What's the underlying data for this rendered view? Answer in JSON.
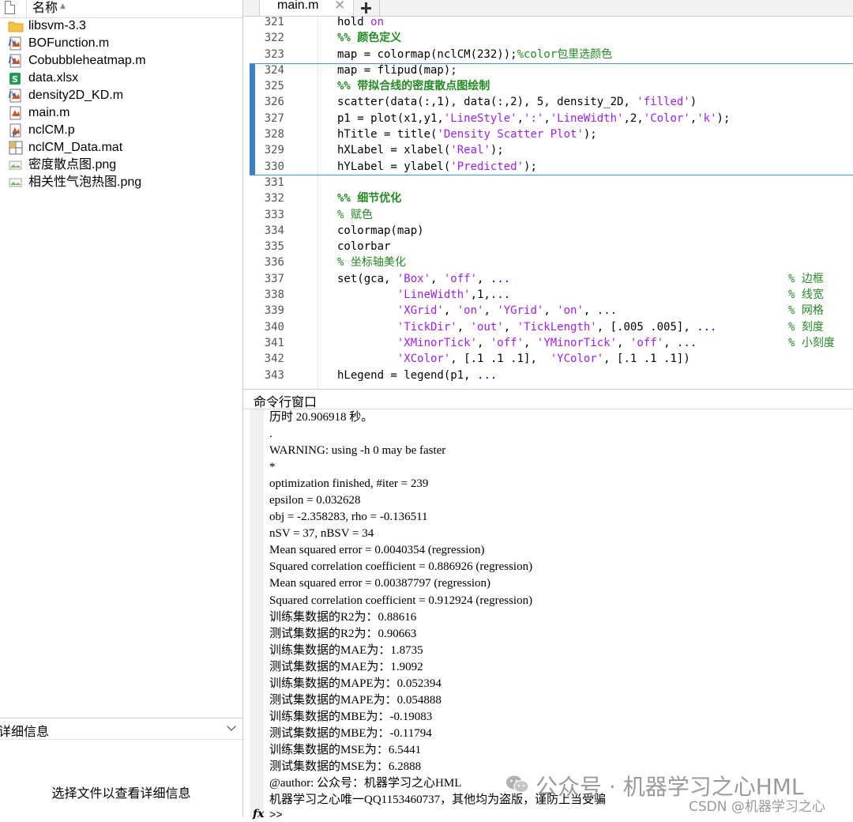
{
  "file_browser": {
    "column_name": "名称",
    "files": [
      {
        "name": "libsvm-3.3",
        "icon": "folder-icon"
      },
      {
        "name": "BOFunction.m",
        "icon": "matlab-function-icon"
      },
      {
        "name": "Cobubbleheatmap.m",
        "icon": "matlab-function-icon"
      },
      {
        "name": "data.xlsx",
        "icon": "excel-icon"
      },
      {
        "name": "density2D_KD.m",
        "icon": "matlab-function-icon"
      },
      {
        "name": "main.m",
        "icon": "matlab-script-icon"
      },
      {
        "name": "nclCM.p",
        "icon": "matlab-pcode-icon"
      },
      {
        "name": "nclCM_Data.mat",
        "icon": "mat-file-icon"
      },
      {
        "name": "密度散点图.png",
        "icon": "png-icon"
      },
      {
        "name": "相关性气泡热图.png",
        "icon": "png-icon"
      }
    ],
    "details_title": "详细信息",
    "details_message": "选择文件以查看详细信息"
  },
  "editor": {
    "tab_label": "main.m",
    "tab_close": "✕",
    "lines": [
      {
        "n": "321",
        "segs": [
          [
            "hold ",
            ""
          ],
          [
            "on",
            "str"
          ]
        ]
      },
      {
        "n": "322",
        "segs": [
          [
            "%% 颜色定义",
            "cmb"
          ]
        ]
      },
      {
        "n": "323",
        "segs": [
          [
            "map = colormap(nclCM(232));",
            ""
          ],
          [
            "%color包里选颜色",
            "cm"
          ]
        ]
      },
      {
        "n": "324",
        "segs": [
          [
            "map = flipud(map);",
            ""
          ]
        ]
      },
      {
        "n": "325",
        "segs": [
          [
            "%% 带拟合线的密度散点图绘制",
            "cmb"
          ]
        ]
      },
      {
        "n": "326",
        "segs": [
          [
            "scatter(data(:,1), data(:,2), 5, density_2D, ",
            ""
          ],
          [
            "'filled'",
            "str"
          ],
          [
            ")",
            ""
          ]
        ]
      },
      {
        "n": "327",
        "segs": [
          [
            "p1 = plot(x1,y1,",
            ""
          ],
          [
            "'LineStyle'",
            "str"
          ],
          [
            ",",
            ""
          ],
          [
            "':'",
            "str"
          ],
          [
            ",",
            ""
          ],
          [
            "'LineWidth'",
            "str"
          ],
          [
            ",2,",
            ""
          ],
          [
            "'Color'",
            "str"
          ],
          [
            ",",
            ""
          ],
          [
            "'k'",
            "str"
          ],
          [
            ");",
            ""
          ]
        ]
      },
      {
        "n": "328",
        "segs": [
          [
            "hTitle = title(",
            ""
          ],
          [
            "'Density Scatter Plot'",
            "str"
          ],
          [
            ");",
            ""
          ]
        ]
      },
      {
        "n": "329",
        "segs": [
          [
            "hXLabel = xlabel(",
            ""
          ],
          [
            "'Real'",
            "str"
          ],
          [
            ");",
            ""
          ]
        ]
      },
      {
        "n": "330",
        "segs": [
          [
            "hYLabel = ylabel(",
            ""
          ],
          [
            "'Predicted'",
            "str"
          ],
          [
            ");",
            ""
          ]
        ]
      },
      {
        "n": "331",
        "segs": []
      },
      {
        "n": "332",
        "segs": [
          [
            "%% 细节优化",
            "cmb"
          ]
        ]
      },
      {
        "n": "333",
        "segs": [
          [
            "% 赋色",
            "cm"
          ]
        ]
      },
      {
        "n": "334",
        "segs": [
          [
            "colormap(map)",
            ""
          ]
        ]
      },
      {
        "n": "335",
        "segs": [
          [
            "colorbar",
            ""
          ]
        ]
      },
      {
        "n": "336",
        "segs": [
          [
            "% 坐标轴美化",
            "cm"
          ]
        ]
      },
      {
        "n": "337",
        "segs": [
          [
            "set(gca, ",
            ""
          ],
          [
            "'Box'",
            "str"
          ],
          [
            ", ",
            ""
          ],
          [
            "'off'",
            "str"
          ],
          [
            ", ",
            ""
          ],
          [
            "...",
            "kw"
          ]
        ],
        "rc": "% 边框"
      },
      {
        "n": "338",
        "segs": [
          [
            "         ",
            ""
          ],
          [
            "'LineWidth'",
            "str"
          ],
          [
            ",1,",
            ""
          ],
          [
            "...",
            "kw"
          ]
        ],
        "rc": "% 线宽"
      },
      {
        "n": "339",
        "segs": [
          [
            "         ",
            ""
          ],
          [
            "'XGrid'",
            "str"
          ],
          [
            ", ",
            ""
          ],
          [
            "'on'",
            "str"
          ],
          [
            ", ",
            ""
          ],
          [
            "'YGrid'",
            "str"
          ],
          [
            ", ",
            ""
          ],
          [
            "'on'",
            "str"
          ],
          [
            ", ",
            ""
          ],
          [
            "...",
            "kw"
          ]
        ],
        "rc": "% 网格"
      },
      {
        "n": "340",
        "segs": [
          [
            "         ",
            ""
          ],
          [
            "'TickDir'",
            "str"
          ],
          [
            ", ",
            ""
          ],
          [
            "'out'",
            "str"
          ],
          [
            ", ",
            ""
          ],
          [
            "'TickLength'",
            "str"
          ],
          [
            ", [.005 .005], ",
            ""
          ],
          [
            "...",
            "kw"
          ]
        ],
        "rc": "% 刻度"
      },
      {
        "n": "341",
        "segs": [
          [
            "         ",
            ""
          ],
          [
            "'XMinorTick'",
            "str"
          ],
          [
            ", ",
            ""
          ],
          [
            "'off'",
            "str"
          ],
          [
            ", ",
            ""
          ],
          [
            "'YMinorTick'",
            "str"
          ],
          [
            ", ",
            ""
          ],
          [
            "'off'",
            "str"
          ],
          [
            ", ",
            ""
          ],
          [
            "...",
            "kw"
          ]
        ],
        "rc": "% 小刻度"
      },
      {
        "n": "342",
        "segs": [
          [
            "         ",
            ""
          ],
          [
            "'XColor'",
            "str"
          ],
          [
            ", [.1 .1 .1],  ",
            ""
          ],
          [
            "'YColor'",
            "str"
          ],
          [
            ", [.1 .1 .1])",
            ""
          ]
        ]
      },
      {
        "n": "343",
        "segs": [
          [
            "hLegend = legend(p1, ",
            ""
          ],
          [
            "...",
            "kw"
          ]
        ]
      }
    ]
  },
  "command_window": {
    "title": "命令行窗口",
    "lines": [
      "历时 20.906918 秒。",
      ".",
      "WARNING: using -h 0 may be faster",
      "*",
      "optimization finished, #iter = 239",
      "epsilon = 0.032628",
      "obj = -2.358283, rho = -0.136511",
      "nSV = 37, nBSV = 34",
      "Mean squared error = 0.0040354 (regression)",
      "Squared correlation coefficient = 0.886926 (regression)",
      "Mean squared error = 0.00387797 (regression)",
      "Squared correlation coefficient = 0.912924 (regression)",
      "训练集数据的R2为：0.88616",
      "测试集数据的R2为：0.90663",
      "训练集数据的MAE为：1.8735",
      "测试集数据的MAE为：1.9092",
      "训练集数据的MAPE为：0.052394",
      "测试集数据的MAPE为：0.054888",
      "训练集数据的MBE为：-0.19083",
      "测试集数据的MBE为：-0.11794",
      "训练集数据的MSE为：6.5441",
      "测试集数据的MSE为：6.2888",
      "@author: 公众号：机器学习之心HML",
      "机器学习之心唯一QQ1153460737，其他均为盗版，谨防上当受骗"
    ],
    "fx_label": "fx",
    "prompt": ">>"
  },
  "watermark": {
    "main": "公众号 · 机器学习之心HML",
    "csdn": "CSDN @机器学习之心"
  },
  "colors": {
    "keyword": "#0000ff",
    "string": "#a020f0",
    "comment": "#228b22",
    "section_bar": "#3b7fc4"
  }
}
